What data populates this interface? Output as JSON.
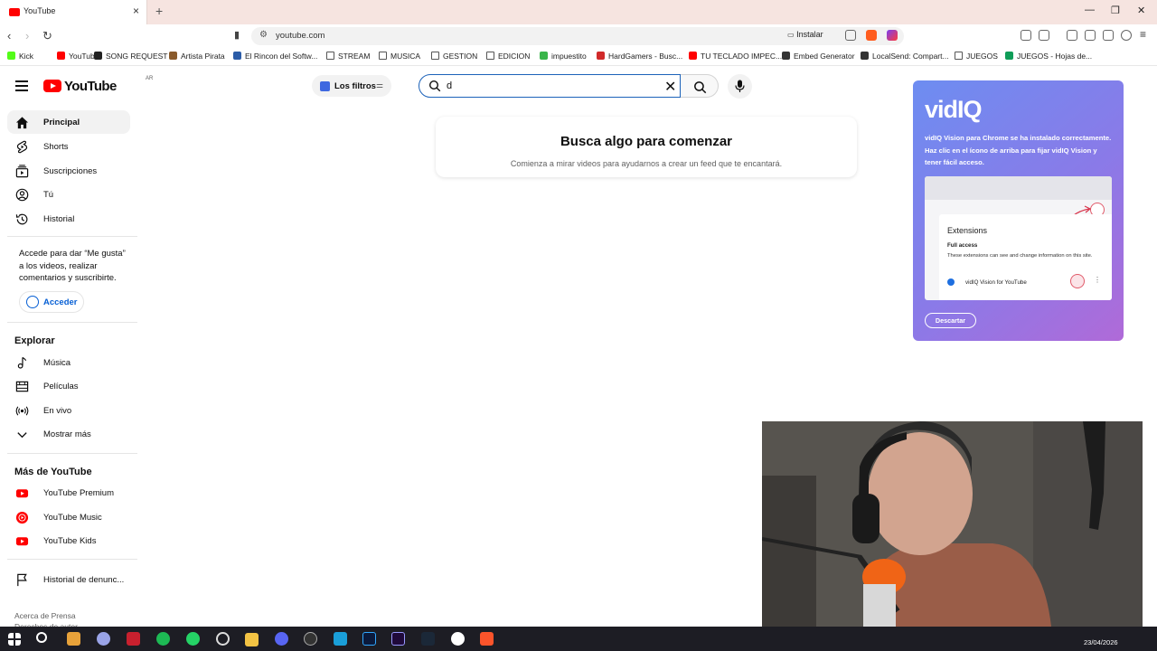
{
  "browser": {
    "tab_title": "YouTube",
    "new_tab": "+",
    "close_tab": "×",
    "url": "youtube.com",
    "install_label": "Instalar",
    "window_controls": [
      "—",
      "❐",
      "✕"
    ]
  },
  "bookmarks": [
    {
      "label": "Kick",
      "color": "#53fc18"
    },
    {
      "label": "YouTube",
      "color": "#ff0000"
    },
    {
      "label": "SONG REQUEST",
      "color": "#222222"
    },
    {
      "label": "Artista Pirata",
      "color": "#8a5a2b"
    },
    {
      "label": "El Rincon del Softw...",
      "color": "#2b5ca8"
    },
    {
      "label": "STREAM",
      "color": "folder"
    },
    {
      "label": "MUSICA",
      "color": "folder"
    },
    {
      "label": "GESTION",
      "color": "folder"
    },
    {
      "label": "EDICION",
      "color": "folder"
    },
    {
      "label": "impuestito",
      "color": "#39b54a"
    },
    {
      "label": "HardGamers - Busc...",
      "color": "#d12a2a"
    },
    {
      "label": "TU TECLADO IMPEC...",
      "color": "#ff0000"
    },
    {
      "label": "Embed Generator",
      "color": "#333333"
    },
    {
      "label": "LocalSend: Compart...",
      "color": "#333333"
    },
    {
      "label": "JUEGOS",
      "color": "folder"
    },
    {
      "label": "JUEGOS - Hojas de...",
      "color": "#0f9d58"
    }
  ],
  "youtube": {
    "logo_text": "YouTube",
    "country_code": "AR",
    "filters_label": "Los filtros",
    "search_value": "d",
    "empty_title": "Busca algo para comenzar",
    "empty_subtitle": "Comienza a mirar videos para ayudarnos a crear un feed que te encantará.",
    "sidebar_main": [
      {
        "label": "Principal",
        "icon": "home-icon"
      },
      {
        "label": "Shorts",
        "icon": "shorts-icon"
      },
      {
        "label": "Suscripciones",
        "icon": "subscriptions-icon"
      },
      {
        "label": "Tú",
        "icon": "you-icon"
      },
      {
        "label": "Historial",
        "icon": "history-icon"
      }
    ],
    "signin_text": "Accede para dar “Me gusta” a los videos, realizar comentarios y suscribirte.",
    "signin_button": "Acceder",
    "explore_heading": "Explorar",
    "sidebar_explore": [
      {
        "label": "Música",
        "icon": "music-icon"
      },
      {
        "label": "Películas",
        "icon": "movies-icon"
      },
      {
        "label": "En vivo",
        "icon": "live-icon"
      },
      {
        "label": "Mostrar más",
        "icon": "chevron-down-icon"
      }
    ],
    "more_heading": "Más de YouTube",
    "sidebar_more": [
      {
        "label": "YouTube Premium",
        "icon": "youtube-premium-icon"
      },
      {
        "label": "YouTube Music",
        "icon": "youtube-music-icon"
      },
      {
        "label": "YouTube Kids",
        "icon": "youtube-kids-icon"
      }
    ],
    "report_history": "Historial de denunc...",
    "footer_line1": "Acerca de  Prensa",
    "footer_line2": "Derechos de autor",
    "hidden_button_fragment": "er"
  },
  "vidiq": {
    "logo": "vidIQ",
    "message": "vidIQ Vision para Chrome se ha instalado correctamente. Haz clic en el ícono de arriba para fijar vidIQ Vision y tener fácil acceso.",
    "extensions_title": "Extensions",
    "full_access": "Full access",
    "access_desc": "These extensions can see and change information on this site.",
    "extension_name": "vidIQ Vision for YouTube",
    "dismiss": "Descartar"
  },
  "taskbar": {
    "date": "23/04/2026"
  },
  "colors": {
    "youtube_red": "#ff0000",
    "link_blue": "#065fd4",
    "tab_strip": "#f6e4e0"
  }
}
